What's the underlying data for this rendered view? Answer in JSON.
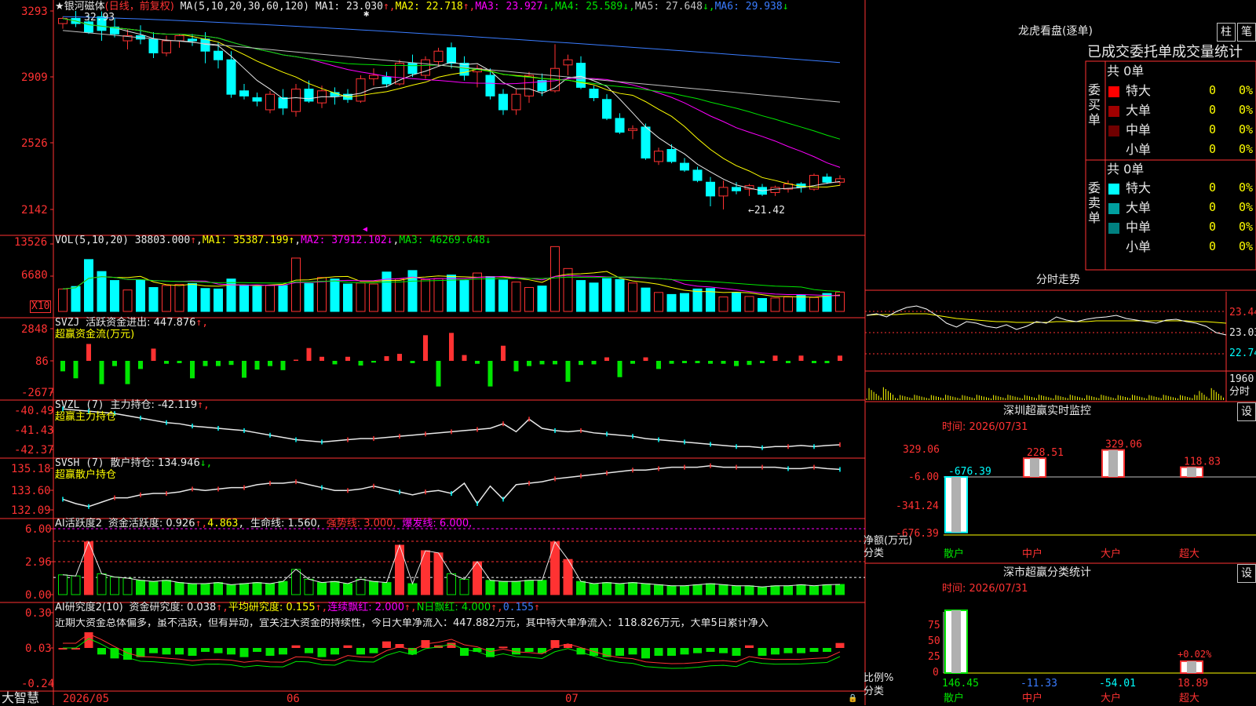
{
  "header": {
    "star": "★",
    "stock_name": "银河磁体",
    "period": "(日线，前复权)",
    "ma_def": "MA(5,10,20,30,60,120)",
    "ma_items": [
      {
        "label": "MA1:",
        "value": "23.030",
        "arrow": "↑",
        "color": "#e8e8e8"
      },
      {
        "label": "MA2:",
        "value": "22.718",
        "arrow": "↑",
        "color": "#ffff00"
      },
      {
        "label": "MA3:",
        "value": "23.927",
        "arrow": "↓",
        "color": "#ff00ff"
      },
      {
        "label": "MA4:",
        "value": "25.589",
        "arrow": "↓",
        "color": "#00e600"
      },
      {
        "label": "MA5:",
        "value": "27.648",
        "arrow": "↓",
        "color": "#c0c0c0"
      },
      {
        "label": "MA6:",
        "value": "29.938",
        "arrow": "↓",
        "color": "#3a7cff"
      }
    ]
  },
  "price_axis": [
    "3293",
    "2909",
    "2526",
    "2142"
  ],
  "price_marks": {
    "high": "32.93",
    "low": "←21.42"
  },
  "vol": {
    "def": "VOL(5,10,20)",
    "value": "38803.000",
    "arrow": "↑",
    "ma1": "MA1: 35387.199↑",
    "ma2": "MA2: 37912.102↓",
    "ma3": "MA3: 46269.648↓",
    "axis": [
      "13526",
      "6680"
    ],
    "unit": "X10"
  },
  "svzj": {
    "def": "SVZJ",
    "label": "活跃资金进出: 447.876",
    "arrow": "↑,",
    "title": "超赢资金流(万元)",
    "axis": [
      "2848",
      "86",
      "-2677"
    ]
  },
  "svzl": {
    "def": "SVZL (7)",
    "label": "主力持仓: -42.119",
    "arrow": "↑,",
    "title": "超赢主力持仓",
    "axis": [
      "-40.49",
      "-41.43",
      "-42.37"
    ]
  },
  "svsh": {
    "def": "SVSH (7)",
    "label": "散户持仓: 134.946",
    "arrow": "↓,",
    "title": "超赢散户持仓",
    "axis": [
      "135.18",
      "133.60",
      "132.09"
    ]
  },
  "ai1": {
    "def": "AI活跃度2",
    "label": "资金活跃度: 0.926",
    "a1": "↑,",
    "v2": "4.863",
    "a2": ",",
    "life": "生命线: 1.560,",
    "strong": "强势线: 3.000,",
    "burst": "爆发线: 6.000,",
    "axis": [
      "6.00",
      "2.96",
      "0.00"
    ]
  },
  "ai2": {
    "def": "AI研究度2(10)",
    "label": "资金研究度: 0.038",
    "a1": "↑,",
    "avg": "平均研究度: 0.155",
    "a2": "↑,",
    "cont": "连续飘红: 2.000",
    "a3": "↑,",
    "nday": "N日飘红: 4.000",
    "a4": "↑,",
    "last": "0.155",
    "a5": "↑",
    "comment": "近期大资金总体偏多，虽不活跃，但有异动，宜关注大资金的持续性，今日大单净流入：447.882万元，其中特大单净流入：118.826万元，大单5日累计净入",
    "axis": [
      "0.30",
      "0.03",
      "-0.24"
    ]
  },
  "date_axis": {
    "brand": "大智慧",
    "labels": [
      "2026/05",
      "06",
      "07"
    ]
  },
  "right": {
    "lhkp_title": "龙虎看盘(逐单)",
    "btn_zhu": "柱",
    "btn_bi": "笔",
    "stat_title": "已成交委托单成交量统计",
    "buy": {
      "side": "委买单",
      "total": "共 0单",
      "rows": [
        {
          "name": "特大",
          "val": "0",
          "pct": "0%",
          "color": "#ff0000"
        },
        {
          "name": "大单",
          "val": "0",
          "pct": "0%",
          "color": "#a00000"
        },
        {
          "name": "中单",
          "val": "0",
          "pct": "0%",
          "color": "#700000"
        },
        {
          "name": "小单",
          "val": "0",
          "pct": "0%",
          "color": "#000000"
        }
      ]
    },
    "sell": {
      "side": "委卖单",
      "total": "共 0单",
      "rows": [
        {
          "name": "特大",
          "val": "0",
          "pct": "0%",
          "color": "#00ffff"
        },
        {
          "name": "大单",
          "val": "0",
          "pct": "0%",
          "color": "#00a0a0"
        },
        {
          "name": "中单",
          "val": "0",
          "pct": "0%",
          "color": "#008080"
        },
        {
          "name": "小单",
          "val": "0",
          "pct": "0%",
          "color": "#000000"
        }
      ]
    },
    "fs_title": "分时走势",
    "fs_axis": [
      "23.44",
      "23.03",
      "22.74"
    ],
    "fs_vol": "1960",
    "fs_unit": "分时",
    "sz_title": "深圳超赢实时监控",
    "sz_btn": "设",
    "sz_time": "时间: 2026/07/31",
    "sz_axis": [
      "329.06",
      "-6.00",
      "-341.24",
      "-676.39"
    ],
    "sz_unit1": "净额(万元)",
    "sz_unit2": "分类",
    "cls_title": "深市超赢分类统计",
    "cls_btn": "设",
    "cls_time": "时间: 2026/07/31",
    "cls_axis": [
      "75",
      "50",
      "25",
      "0"
    ],
    "cls_unit1": "比例%",
    "cls_unit2": "分类",
    "cats": [
      "散户",
      "中户",
      "大户",
      "超大"
    ]
  },
  "chart_data": [
    {
      "type": "candlestick",
      "title": "银河磁体 (日线，前复权)",
      "ylim": [
        21.2,
        33.6
      ],
      "y_ticks": [
        32.93,
        29.09,
        25.26,
        21.42
      ],
      "x_labels": [
        "2026/05",
        "06",
        "07"
      ],
      "ohlc": [
        [
          32.2,
          32.6,
          31.9,
          32.5
        ],
        [
          32.5,
          32.93,
          32.0,
          32.2
        ],
        [
          32.3,
          32.7,
          31.6,
          31.7
        ],
        [
          32.6,
          32.9,
          31.2,
          31.8
        ],
        [
          32.0,
          32.5,
          31.4,
          31.6
        ],
        [
          31.2,
          31.9,
          30.7,
          31.5
        ],
        [
          31.5,
          32.1,
          31.0,
          31.3
        ],
        [
          31.3,
          31.7,
          30.2,
          30.5
        ],
        [
          30.5,
          31.5,
          30.3,
          31.2
        ],
        [
          31.2,
          31.6,
          30.8,
          31.5
        ],
        [
          31.3,
          31.6,
          30.9,
          31.2
        ],
        [
          31.3,
          31.7,
          29.9,
          30.6
        ],
        [
          30.6,
          31.1,
          29.6,
          30.1
        ],
        [
          30.1,
          30.6,
          27.9,
          28.1
        ],
        [
          28.3,
          28.7,
          27.8,
          28.0
        ],
        [
          27.9,
          28.2,
          27.4,
          27.7
        ],
        [
          27.2,
          28.3,
          27.0,
          28.1
        ],
        [
          27.9,
          28.4,
          26.9,
          27.3
        ],
        [
          27.1,
          28.7,
          26.8,
          28.4
        ],
        [
          28.4,
          28.9,
          27.6,
          27.7
        ],
        [
          27.6,
          28.6,
          27.3,
          28.3
        ],
        [
          28.2,
          28.5,
          27.5,
          28.0
        ],
        [
          28.1,
          28.4,
          27.6,
          27.8
        ],
        [
          27.7,
          29.2,
          27.6,
          29.0
        ],
        [
          29.0,
          29.6,
          28.6,
          29.2
        ],
        [
          29.1,
          29.4,
          28.5,
          28.7
        ],
        [
          28.7,
          30.1,
          28.6,
          29.9
        ],
        [
          29.9,
          30.4,
          29.1,
          29.3
        ],
        [
          29.2,
          30.3,
          29.0,
          30.1
        ],
        [
          30.0,
          30.8,
          29.7,
          30.6
        ],
        [
          30.8,
          31.1,
          29.6,
          29.9
        ],
        [
          29.9,
          30.3,
          28.9,
          29.2
        ],
        [
          29.4,
          29.8,
          28.5,
          29.6
        ],
        [
          29.2,
          29.6,
          27.8,
          28.0
        ],
        [
          28.1,
          28.4,
          26.9,
          27.2
        ],
        [
          27.2,
          28.4,
          26.9,
          28.1
        ],
        [
          28.0,
          29.4,
          27.6,
          29.2
        ],
        [
          28.9,
          29.3,
          28.0,
          28.3
        ],
        [
          28.3,
          31.0,
          28.2,
          29.6
        ],
        [
          29.8,
          30.4,
          29.2,
          30.1
        ],
        [
          29.9,
          30.3,
          28.4,
          28.5
        ],
        [
          28.4,
          28.6,
          27.7,
          27.9
        ],
        [
          27.8,
          28.1,
          26.6,
          26.7
        ],
        [
          26.7,
          27.0,
          25.8,
          25.9
        ],
        [
          26.0,
          26.3,
          25.5,
          26.1
        ],
        [
          26.2,
          26.4,
          24.3,
          24.4
        ],
        [
          24.2,
          25.0,
          24.0,
          24.8
        ],
        [
          24.9,
          25.2,
          24.1,
          24.2
        ],
        [
          24.1,
          24.4,
          23.6,
          23.7
        ],
        [
          23.7,
          23.9,
          23.0,
          23.1
        ],
        [
          23.0,
          23.3,
          21.6,
          22.2
        ],
        [
          22.2,
          23.1,
          21.42,
          22.7
        ],
        [
          22.7,
          23.0,
          22.3,
          22.5
        ],
        [
          22.6,
          22.9,
          22.2,
          22.8
        ],
        [
          22.7,
          22.9,
          22.2,
          22.3
        ],
        [
          22.4,
          22.8,
          22.2,
          22.7
        ],
        [
          22.6,
          23.1,
          22.4,
          22.9
        ],
        [
          22.9,
          23.0,
          22.4,
          22.7
        ],
        [
          22.6,
          23.5,
          22.5,
          23.4
        ],
        [
          23.3,
          23.5,
          22.9,
          23.0
        ],
        [
          23.0,
          23.4,
          22.8,
          23.2
        ]
      ],
      "ma_series": [
        {
          "name": "MA1",
          "last": 23.03
        },
        {
          "name": "MA2",
          "last": 22.718
        },
        {
          "name": "MA3",
          "last": 23.927
        },
        {
          "name": "MA4",
          "last": 25.589
        },
        {
          "name": "MA5",
          "last": 27.648
        },
        {
          "name": "MA6",
          "last": 29.938
        }
      ]
    },
    {
      "type": "bar",
      "title": "VOL(5,10,20)",
      "ylim": [
        0,
        13526
      ],
      "y_ticks": [
        13526,
        6680
      ],
      "values": [
        4500,
        5000,
        10400,
        8000,
        6200,
        4300,
        6300,
        4800,
        5200,
        5400,
        5600,
        4600,
        4500,
        6500,
        5300,
        5000,
        5200,
        5200,
        10700,
        5600,
        6800,
        6500,
        5500,
        5700,
        5500,
        7900,
        6500,
        8200,
        6400,
        6600,
        7300,
        6200,
        7700,
        7000,
        6300,
        5900,
        4800,
        5100,
        13000,
        8600,
        6200,
        5700,
        6600,
        6400,
        5700,
        4700,
        3800,
        3400,
        3600,
        4500,
        4600,
        2900,
        3700,
        3000,
        2600,
        2700,
        2900,
        3300,
        2800,
        3600,
        3880
      ]
    },
    {
      "type": "bar",
      "title": "超赢资金流(万元)",
      "ylim": [
        -2677,
        2848
      ],
      "values": [
        -900,
        -1500,
        1450,
        -2000,
        -450,
        -2000,
        -700,
        1050,
        -250,
        -200,
        -1500,
        -450,
        -450,
        -350,
        -1450,
        -750,
        -450,
        -800,
        100,
        1100,
        350,
        -300,
        350,
        -400,
        -150,
        400,
        600,
        -200,
        2200,
        -2200,
        2400,
        500,
        -250,
        -2200,
        1300,
        -900,
        -450,
        -300,
        -300,
        -1800,
        -350,
        -300,
        300,
        -1400,
        -250,
        300,
        -700,
        -250,
        -200,
        -200,
        -250,
        -250,
        -450,
        -350,
        -200,
        450,
        -200,
        450,
        -200,
        -200,
        448
      ]
    },
    {
      "type": "line",
      "title": "超赢主力持仓",
      "ylim": [
        -42.5,
        -40.3
      ],
      "values": [
        -40.55,
        -40.6,
        -40.65,
        -40.7,
        -40.75,
        -40.85,
        -40.95,
        -41.05,
        -41.15,
        -41.2,
        -41.3,
        -41.35,
        -41.4,
        -41.45,
        -41.5,
        -41.6,
        -41.7,
        -41.8,
        -41.9,
        -41.95,
        -42.0,
        -41.95,
        -41.9,
        -41.85,
        -41.85,
        -41.8,
        -41.75,
        -41.7,
        -41.65,
        -41.6,
        -41.55,
        -41.5,
        -41.45,
        -41.4,
        -41.2,
        -41.55,
        -41.0,
        -41.4,
        -41.5,
        -41.55,
        -41.5,
        -41.6,
        -41.65,
        -41.7,
        -41.75,
        -41.85,
        -41.9,
        -41.95,
        -42.0,
        -42.05,
        -42.1,
        -42.15,
        -42.2,
        -42.2,
        -42.25,
        -42.2,
        -42.2,
        -42.15,
        -42.2,
        -42.15,
        -42.12
      ]
    },
    {
      "type": "line",
      "title": "超赢散户持仓",
      "ylim": [
        131.9,
        135.4
      ],
      "values": [
        132.9,
        132.6,
        132.4,
        132.7,
        133.0,
        133.0,
        133.2,
        133.3,
        133.3,
        133.4,
        133.6,
        133.5,
        133.6,
        133.7,
        133.7,
        133.9,
        134.0,
        134.0,
        134.1,
        133.9,
        133.7,
        133.5,
        133.5,
        133.6,
        133.8,
        133.6,
        133.4,
        133.2,
        133.4,
        133.5,
        133.3,
        134.0,
        132.6,
        133.8,
        132.9,
        133.9,
        134.0,
        134.1,
        134.3,
        134.4,
        134.5,
        134.6,
        134.7,
        134.8,
        134.9,
        134.9,
        135.0,
        135.1,
        135.1,
        135.1,
        135.2,
        135.1,
        135.1,
        135.1,
        135.1,
        135.1,
        135.0,
        135.0,
        135.1,
        135.0,
        134.946
      ]
    },
    {
      "type": "bar",
      "title": "AI活跃度2",
      "ylim": [
        0,
        6.0
      ],
      "lines": {
        "life": 1.56,
        "strong": 3.0,
        "burst": 6.0
      },
      "values": [
        1.8,
        1.7,
        4.8,
        1.9,
        1.6,
        1.5,
        1.3,
        1.2,
        1.3,
        1.1,
        1.0,
        1.0,
        1.1,
        0.9,
        1.0,
        1.1,
        1.0,
        1.2,
        2.3,
        1.4,
        1.1,
        1.2,
        1.0,
        1.4,
        1.2,
        1.1,
        4.5,
        1.0,
        4.0,
        3.8,
        1.9,
        1.4,
        3.0,
        1.3,
        1.2,
        1.2,
        1.3,
        1.3,
        4.8,
        3.2,
        1.2,
        1.0,
        1.1,
        1.0,
        1.1,
        1.0,
        0.9,
        0.8,
        0.8,
        0.9,
        1.0,
        0.9,
        0.8,
        0.8,
        0.7,
        0.8,
        0.8,
        0.9,
        0.8,
        0.9,
        0.926
      ]
    },
    {
      "type": "bar",
      "title": "AI研究度2(10)",
      "ylim": [
        -0.24,
        0.3
      ],
      "values": [
        0.0,
        0.0,
        0.12,
        -0.05,
        -0.08,
        -0.09,
        -0.07,
        -0.04,
        -0.05,
        -0.05,
        -0.06,
        -0.03,
        -0.04,
        -0.05,
        -0.07,
        -0.03,
        -0.06,
        -0.05,
        0.02,
        -0.04,
        -0.07,
        -0.05,
        0.02,
        -0.05,
        -0.04,
        0.05,
        0.03,
        -0.05,
        0.06,
        0.02,
        0.04,
        -0.06,
        -0.03,
        -0.07,
        0.01,
        -0.05,
        -0.03,
        -0.04,
        0.06,
        0.03,
        -0.05,
        -0.06,
        -0.07,
        -0.06,
        -0.05,
        -0.08,
        -0.06,
        -0.06,
        -0.05,
        -0.04,
        -0.03,
        -0.04,
        -0.06,
        0.02,
        -0.06,
        -0.05,
        -0.04,
        -0.04,
        -0.03,
        -0.03,
        0.038
      ]
    },
    {
      "type": "line",
      "title": "分时走势",
      "ylim": [
        22.74,
        23.44
      ],
      "y_ticks": [
        23.44,
        23.03,
        22.74
      ],
      "ref": 23.03,
      "price": [
        23.2,
        23.22,
        23.18,
        23.25,
        23.3,
        23.32,
        23.28,
        23.2,
        23.1,
        23.05,
        23.12,
        23.1,
        23.06,
        23.04,
        23.08,
        23.02,
        23.06,
        23.12,
        23.1,
        23.18,
        23.14,
        23.12,
        23.15,
        23.17,
        23.18,
        23.2,
        23.16,
        23.14,
        23.12,
        23.1,
        23.14,
        23.15,
        23.12,
        23.1,
        23.06,
        22.98,
        22.95
      ],
      "avg": [
        23.2,
        23.21,
        23.21,
        23.21,
        23.22,
        23.22,
        23.22,
        23.2,
        23.18,
        23.16,
        23.15,
        23.14,
        23.13,
        23.12,
        23.12,
        23.11,
        23.11,
        23.11,
        23.11,
        23.12,
        23.12,
        23.12,
        23.12,
        23.13,
        23.13,
        23.13,
        23.13,
        23.13,
        23.13,
        23.13,
        23.13,
        23.13,
        23.13,
        23.12,
        23.12,
        23.11,
        23.1
      ],
      "volume_max": 1960
    },
    {
      "type": "bar",
      "title": "深圳超赢实时监控",
      "categories": [
        "散户",
        "中户",
        "大户",
        "超大"
      ],
      "values": [
        -676.39,
        228.51,
        329.06,
        118.83
      ],
      "ylim": [
        -676.39,
        329.06
      ],
      "y_ticks": [
        329.06,
        -6.0,
        -341.24,
        -676.39
      ]
    },
    {
      "type": "bar",
      "title": "深市超赢分类统计",
      "categories": [
        "散户",
        "中户",
        "大户",
        "超大"
      ],
      "values": [
        146.45,
        -11.33,
        -54.01,
        18.89
      ],
      "annotation": "+0.02%",
      "ylim": [
        0,
        100
      ],
      "y_ticks": [
        75,
        50,
        25,
        0
      ]
    }
  ]
}
